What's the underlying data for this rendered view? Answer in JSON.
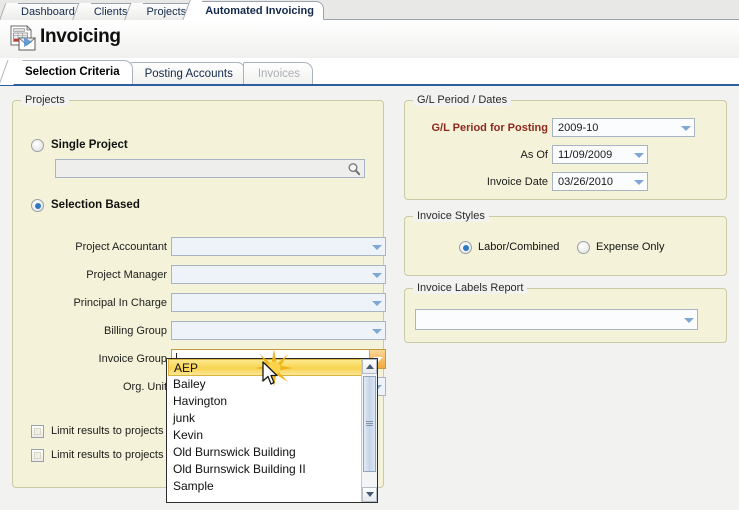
{
  "app": {
    "tabs": [
      {
        "label": "Dashboard",
        "active": false
      },
      {
        "label": "Clients",
        "active": false
      },
      {
        "label": "Projects",
        "active": false
      },
      {
        "label": "Automated Invoicing",
        "active": true
      }
    ]
  },
  "header": {
    "title": "Invoicing",
    "icon": "invoice-document-icon"
  },
  "subtabs": [
    {
      "label": "Selection Criteria",
      "state": "active"
    },
    {
      "label": "Posting Accounts",
      "state": "normal"
    },
    {
      "label": "Invoices",
      "state": "disabled"
    }
  ],
  "projects_panel": {
    "legend": "Projects",
    "single_project": {
      "label": "Single Project",
      "selected": false,
      "search_value": "",
      "search_icon": "magnifier-icon"
    },
    "selection_based": {
      "label": "Selection Based",
      "selected": true
    },
    "fields": [
      {
        "label": "Project Accountant",
        "value": "",
        "state": "normal"
      },
      {
        "label": "Project Manager",
        "value": "",
        "state": "normal"
      },
      {
        "label": "Principal In Charge",
        "value": "",
        "state": "normal"
      },
      {
        "label": "Billing Group",
        "value": "",
        "state": "normal"
      },
      {
        "label": "Invoice Group",
        "value": "",
        "state": "focused"
      },
      {
        "label": "Org. Unit",
        "value": "",
        "state": "normal"
      }
    ],
    "checkboxes": [
      {
        "label": "Limit results to projects re",
        "checked": false
      },
      {
        "label": "Limit results to projects re",
        "checked": false
      }
    ]
  },
  "dropdown": {
    "open": true,
    "for_field": "Invoice Group",
    "items": [
      "AEP",
      "Bailey",
      "Havington",
      "junk",
      "Kevin",
      "Old Burnswick Building",
      "Old Burnswick Building II",
      "Sample"
    ],
    "selected_index": 0,
    "scrollbar": {
      "up_icon": "scroll-up-arrow-icon",
      "down_icon": "scroll-down-arrow-icon"
    }
  },
  "gl_panel": {
    "legend": "G/L Period / Dates",
    "rows": [
      {
        "label": "G/L Period for Posting",
        "value": "2009-10",
        "emphasis": "accent"
      },
      {
        "label": "As Of",
        "value": "11/09/2009",
        "emphasis": "normal"
      },
      {
        "label": "Invoice Date",
        "value": "03/26/2010",
        "emphasis": "normal"
      }
    ]
  },
  "styles_panel": {
    "legend": "Invoice Styles",
    "options": [
      {
        "label": "Labor/Combined",
        "selected": true
      },
      {
        "label": "Expense Only",
        "selected": false
      }
    ]
  },
  "labels_panel": {
    "legend": "Invoice Labels Report",
    "value": ""
  },
  "colors": {
    "panel_bg": "#f4f3d9",
    "page_bg": "#f2f2f0",
    "accent_red": "#8c2a20",
    "tab_underline": "#2b5f9e",
    "highlight_yellow": "#f8d451",
    "focus_orange": "#f2a93c"
  }
}
